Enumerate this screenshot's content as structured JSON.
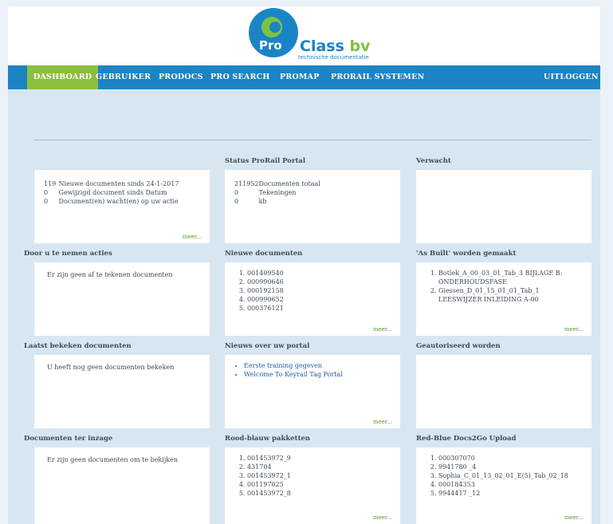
{
  "logo": {
    "pro": "Pro",
    "class": "Class",
    "bv": " bv",
    "tagline": "technische documentatie"
  },
  "nav": {
    "items": [
      "DASHBOARD",
      "GEBRUIKER",
      "PRODOCS",
      "PRO SEARCH",
      "PROMAP",
      "PRORAIL SYSTEMEN"
    ],
    "logout": "UITLOGGEN",
    "active": "DASHBOARD"
  },
  "colors": {
    "nav": "#1c84c3",
    "active": "#8cbf3f",
    "more": "#5a9e2f"
  },
  "more_label": "meer...",
  "row1": {
    "stats": {
      "lines": [
        {
          "n": "119",
          "t": "Nieuwe documenten sinds 24-1-2017"
        },
        {
          "n": "0",
          "t": "Gewijzigd document sinds Datum"
        },
        {
          "n": "0",
          "t": "Document(en) wacht(en) op uw actie"
        }
      ]
    },
    "status": {
      "title": "Status ProRail Portal",
      "lines": [
        {
          "n": "211952",
          "t": "Documenten totaal"
        },
        {
          "n": "0",
          "t": "Tekeningen"
        },
        {
          "n": "0",
          "t": "kb"
        }
      ]
    },
    "verwacht": {
      "title": "Verwacht"
    }
  },
  "row2": {
    "acties": {
      "title": "Door u te nemen acties",
      "text": "Er zijn geen af te tekenen documenten"
    },
    "nieuwe": {
      "title": "Nieuwe documenten",
      "items": [
        "001409540",
        "000990646",
        "000192158",
        "000990652",
        "000376121"
      ]
    },
    "asbuilt": {
      "title": "'As Built' worden gemaakt",
      "items": [
        "Botlek_A_00_03_01_Tab_3 BIJLAGE B: ONDERHOUDSFASE",
        "Giessen_D_01_15_01_01_Tab_1 LEESWIJZER INLEIDING A-00"
      ]
    }
  },
  "row3": {
    "laatst": {
      "title": "Laatst bekeken documenten",
      "text": "U heeft nog geen documenten bekeken"
    },
    "nieuws": {
      "title": "Nieuws over uw portal",
      "items": [
        "Eerste training gegeven",
        "Welcome To Keyrail Tag Portal"
      ]
    },
    "geautoriseerd": {
      "title": "Geautoriseerd worden"
    }
  },
  "row4": {
    "inzage": {
      "title": "Documenten ter inzage",
      "text": "Er zijn geen documenten om te bekijken"
    },
    "roodblauw": {
      "title": "Rood-blauw pakketten",
      "items": [
        "001453972_9",
        "431704",
        "001453972_1",
        "001197025",
        "001453972_8"
      ]
    },
    "docs2go": {
      "title": "Red-Blue Docs2Go Upload",
      "items": [
        "000307070",
        "9941780 _4",
        "Sophia_C_01_13_02_01_E(5)_Tab_02_18",
        "000184353",
        "9944417 _12"
      ]
    }
  }
}
